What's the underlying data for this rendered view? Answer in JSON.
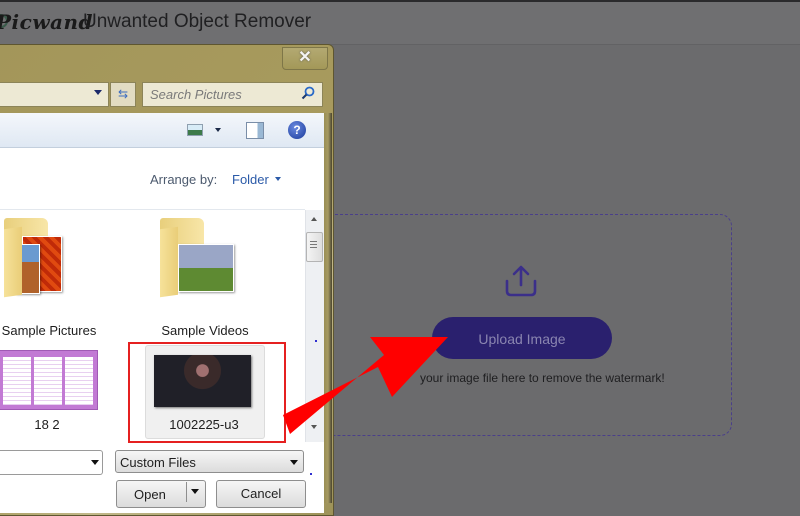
{
  "app": {
    "logo_text": "Picwand",
    "title": "Unwanted Object Remover"
  },
  "upload_area": {
    "icon": "upload-icon",
    "button_label": "Upload Image",
    "hint": "Drop your image file here to remove the watermark!",
    "hint_visible": "your image file here to remove the watermark!",
    "accent_color": "#2a206e"
  },
  "dialog": {
    "close_label": "✕",
    "search_placeholder": "Search Pictures",
    "toolbar": {
      "view_icon": "change-view-icon",
      "preview_pane_icon": "preview-pane-icon",
      "help_label": "?"
    },
    "arrange_by_label": "Arrange by:",
    "arrange_by_value": "Folder",
    "items": [
      {
        "label": "Sample Pictures",
        "type": "folder"
      },
      {
        "label": "Sample Videos",
        "type": "folder"
      },
      {
        "label": "18 2",
        "type": "image"
      },
      {
        "label": "1002225-u3",
        "type": "image",
        "selected": true
      }
    ],
    "file_name_value": "",
    "file_type_value": "Custom Files",
    "open_label": "Open",
    "cancel_label": "Cancel"
  },
  "annotation": {
    "highlight_color": "#e52020",
    "arrow_color": "#ff0000"
  }
}
